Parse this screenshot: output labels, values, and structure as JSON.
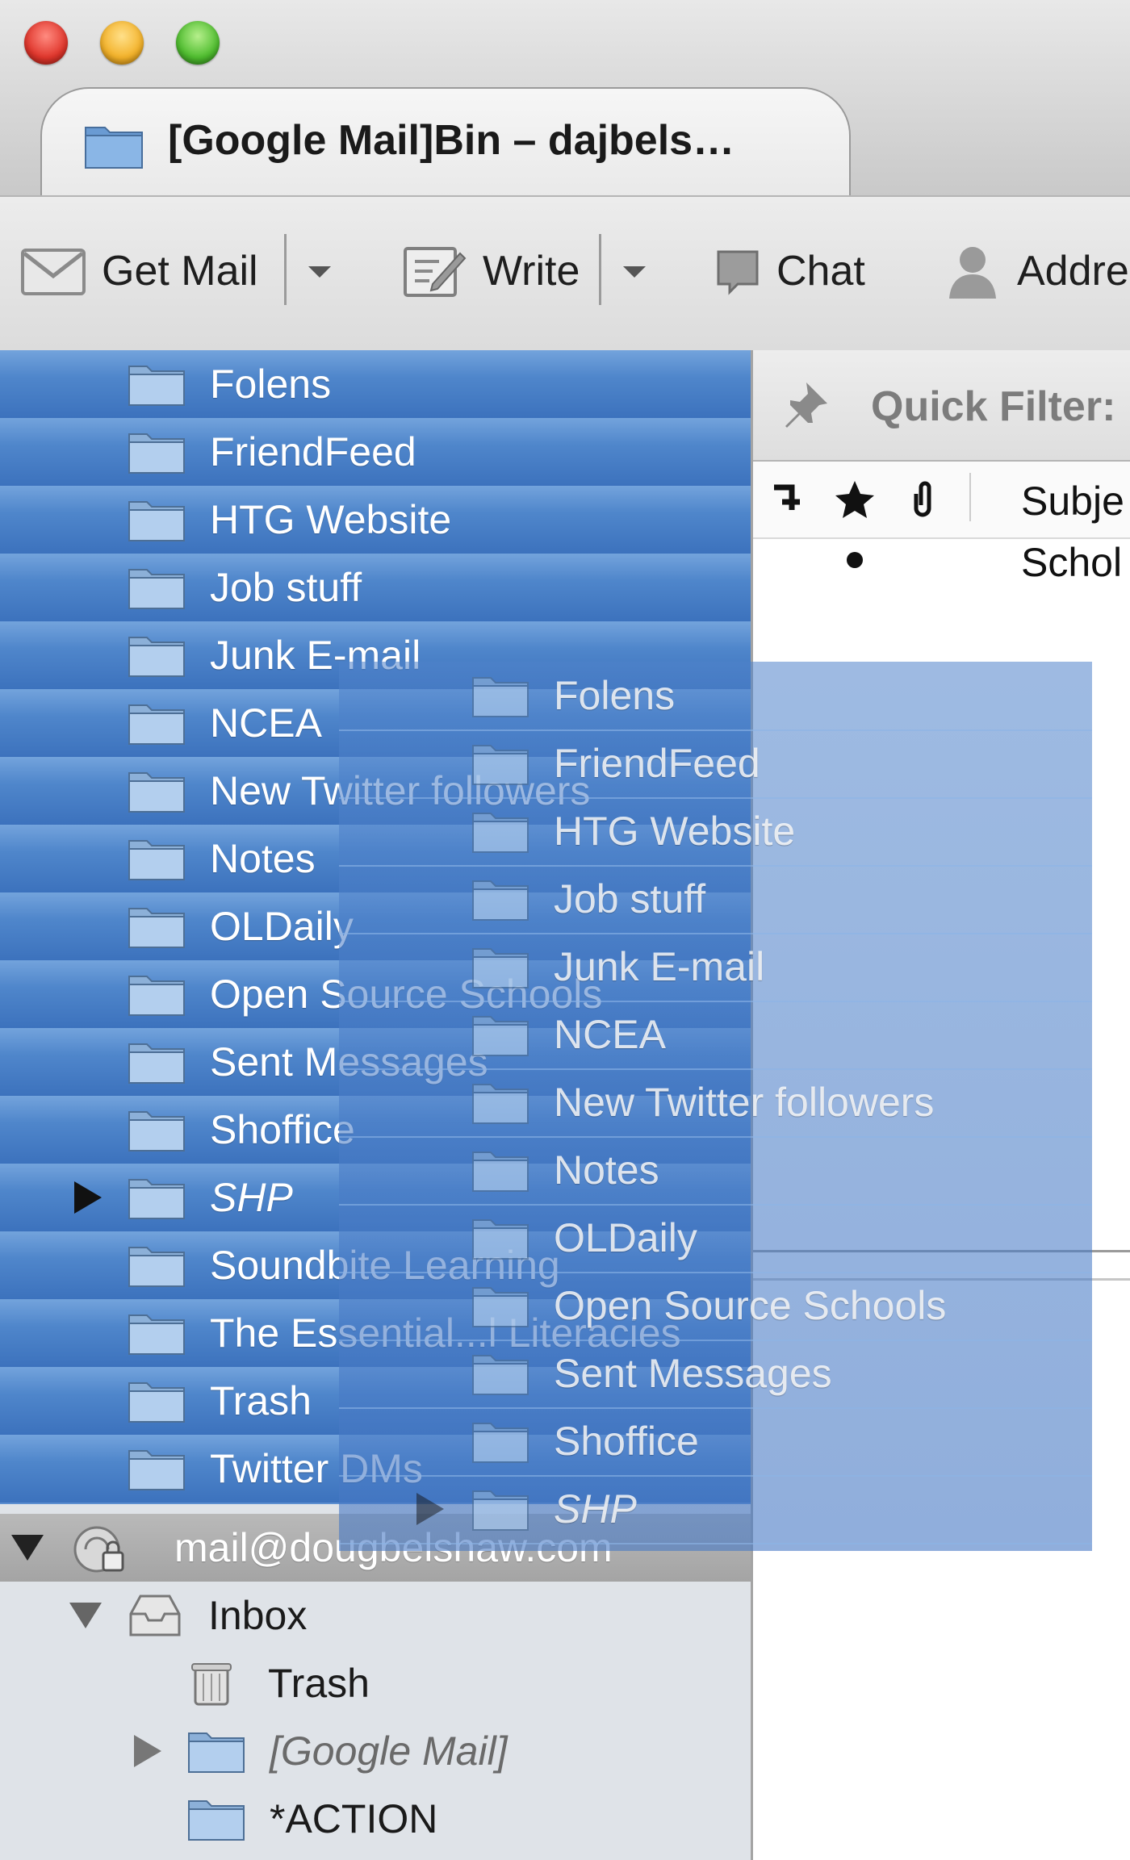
{
  "window": {
    "tab_title": "[Google Mail]Bin – dajbels…"
  },
  "toolbar": {
    "get_mail": "Get Mail",
    "write": "Write",
    "chat": "Chat",
    "address_book": "Addre"
  },
  "folders": {
    "selected_rows": [
      "Folens",
      "FriendFeed",
      "HTG Website",
      "Job stuff",
      "Junk E-mail",
      "NCEA",
      "New Twitter followers",
      "Notes",
      "OLDaily",
      "Open Source Schools",
      "Sent Messages",
      "Shoffice",
      "SHP",
      "Soundbite Learning",
      "The Essential...l Literacies",
      "Trash",
      "Twitter DMs"
    ],
    "account": "mail@dougbelshaw.com",
    "account_children": [
      "Inbox",
      "Trash",
      "[Google Mail]",
      "*ACTION"
    ]
  },
  "drag_ghost": {
    "rows": [
      "Folens",
      "FriendFeed",
      "HTG Website",
      "Job stuff",
      "Junk E-mail",
      "NCEA",
      "New Twitter followers",
      "Notes",
      "OLDaily",
      "Open Source Schools",
      "Sent Messages",
      "Shoffice",
      "SHP"
    ]
  },
  "message_pane": {
    "quick_filter": "Quick Filter:",
    "subject_header": "Subje",
    "first_row_subject": "Schol"
  }
}
